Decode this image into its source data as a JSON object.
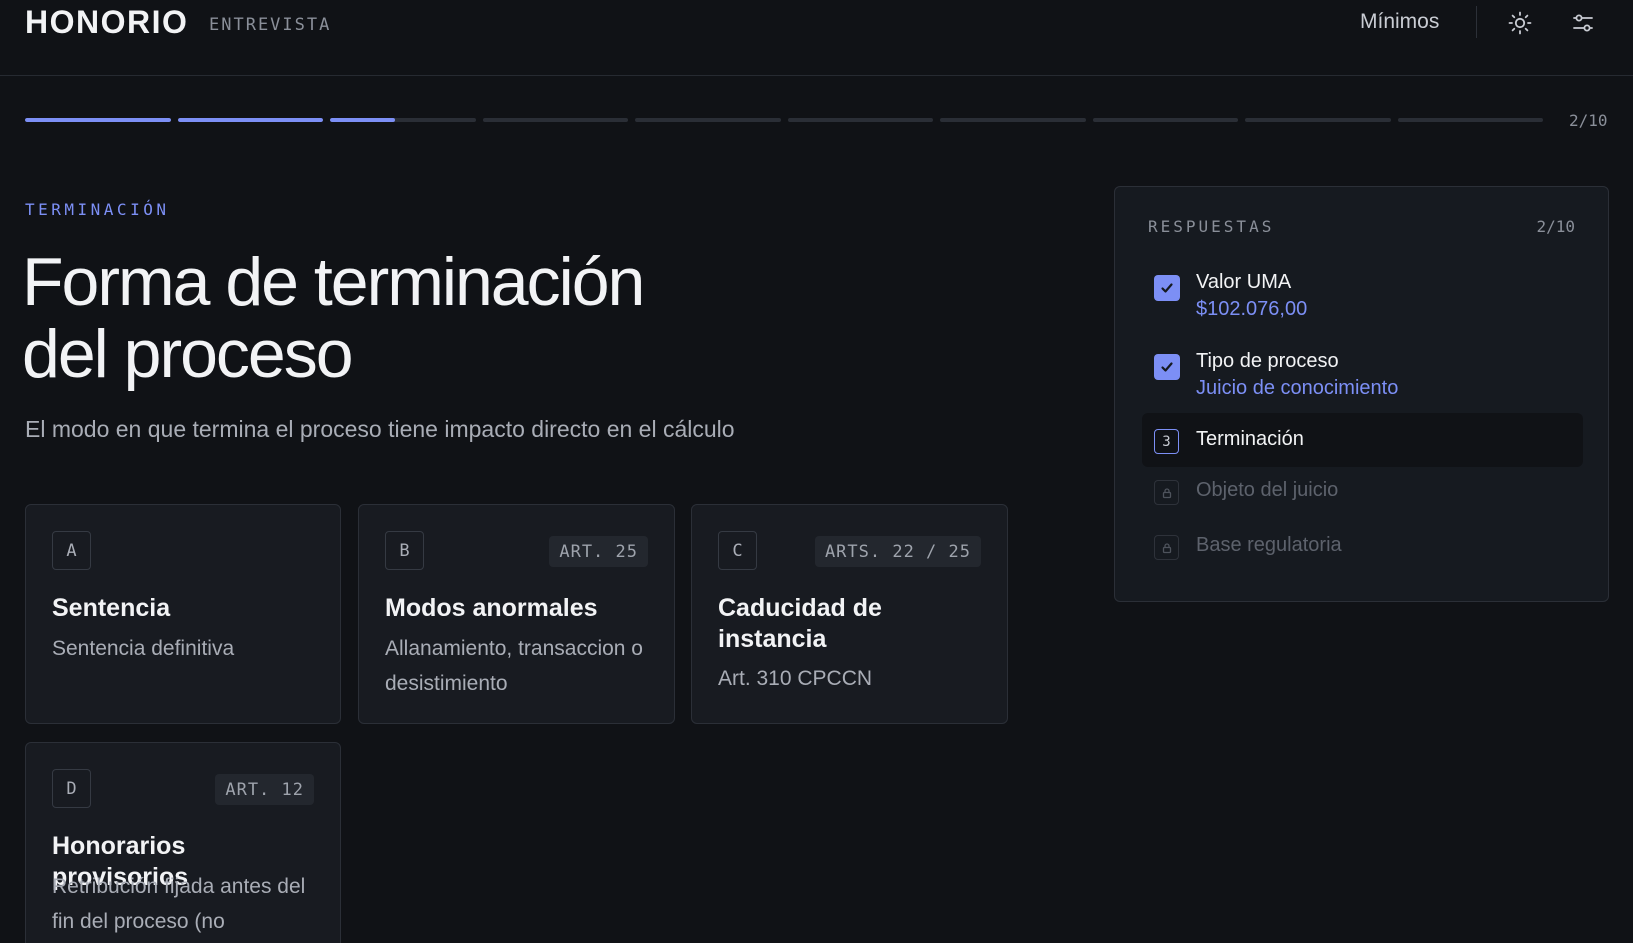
{
  "header": {
    "brand": "HONORIO",
    "brand_sub": "ENTREVISTA",
    "nav_link": "Mínimos",
    "icons": [
      "sun-icon",
      "sliders-icon"
    ]
  },
  "progress": {
    "total_steps": 10,
    "current_step_fraction": 0.45,
    "completed_steps": 2,
    "count_label": "2/10",
    "accent_color": "#7c8ff5"
  },
  "step": {
    "eyebrow": "TERMINACIÓN",
    "title_line1": "Forma de terminación",
    "title_line2": "del proceso",
    "subtitle": "El modo en que termina el proceso tiene impacto directo en el cálculo"
  },
  "options": [
    {
      "letter": "A",
      "tag": "",
      "title": "Sentencia",
      "description": "Sentencia definitiva"
    },
    {
      "letter": "B",
      "tag": "ART. 25",
      "title": "Modos anormales",
      "description": "Allanamiento, transaccion o desistimiento"
    },
    {
      "letter": "C",
      "tag": "ARTS. 22 / 25",
      "title": "Caducidad de instancia",
      "description": "Art. 310 CPCCN"
    },
    {
      "letter": "D",
      "tag": "ART. 12",
      "title": "Honorarios provisorios",
      "description": "Retribución fijada antes del fin del proceso (no"
    }
  ],
  "answers": {
    "heading": "RESPUESTAS",
    "count": "2/10",
    "items": [
      {
        "label": "Valor UMA",
        "value": "$102.076,00",
        "state": "done"
      },
      {
        "label": "Tipo de proceso",
        "value": "Juicio de conocimiento",
        "state": "done"
      },
      {
        "number": "3",
        "label": "Terminación",
        "state": "current"
      },
      {
        "label": "Objeto del juicio",
        "state": "locked"
      },
      {
        "label": "Base regulatoria",
        "state": "locked"
      }
    ]
  }
}
